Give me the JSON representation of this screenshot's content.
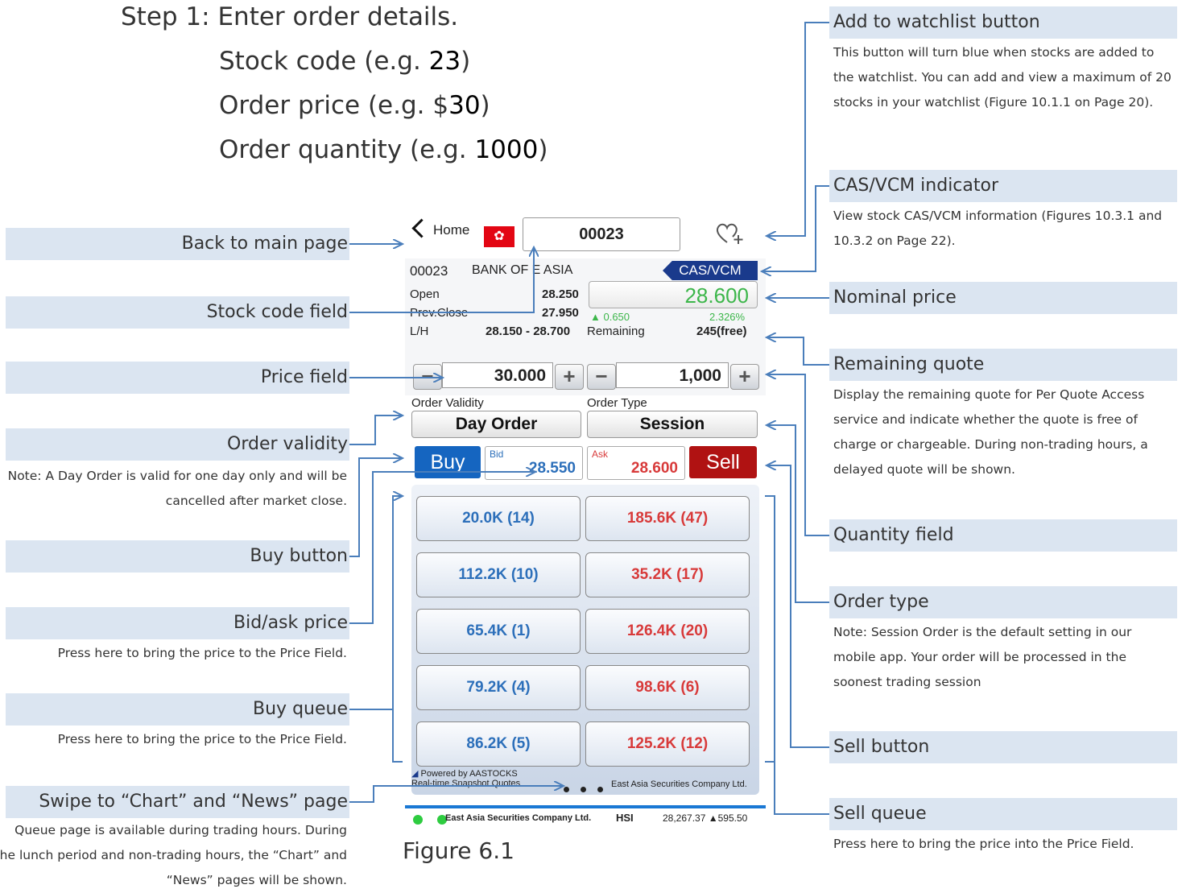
{
  "steps": {
    "title": "Step 1: Enter order details.",
    "stock_code": [
      "Stock code (e.g. ",
      "23",
      ")"
    ],
    "order_price": [
      "Order price (e.g. $",
      "30",
      ")"
    ],
    "order_qty": [
      "Order quantity (e.g. ",
      "1000",
      ")"
    ]
  },
  "left_callouts": [
    {
      "label": "Back to main page"
    },
    {
      "label": "Stock code field"
    },
    {
      "label": "Price field"
    },
    {
      "label": "Order validity",
      "note": "Note: A Day Order is valid for one day only and will be cancelled after market close."
    },
    {
      "label": "Buy button"
    },
    {
      "label": "Bid/ask price",
      "note": "Press here to bring the price to the Price Field."
    },
    {
      "label": "Buy queue",
      "note": "Press here to bring the price to the Price Field."
    },
    {
      "label": "Swipe to “Chart” and “News” page",
      "note": "Queue page is available during trading hours. During the lunch period and non-trading hours, the “Chart” and “News” pages will be shown."
    }
  ],
  "right_callouts": [
    {
      "label": "Add to watchlist button",
      "note": "This button will turn blue when stocks are added to the watchlist. You can add and view a maximum of 20 stocks in your watchlist (Figure 10.1.1 on Page 20)."
    },
    {
      "label": "CAS/VCM indicator",
      "note": "View stock CAS/VCM information (Figures 10.3.1 and 10.3.2 on Page 22)."
    },
    {
      "label": "Nominal price"
    },
    {
      "label": "Remaining quote",
      "note": "Display the remaining quote for Per Quote Access service and indicate whether the quote is free of charge or chargeable. During non-trading hours, a delayed quote will be shown."
    },
    {
      "label": "Quantity field"
    },
    {
      "label": "Order type",
      "note": "Note: Session Order is the default setting in our mobile app. Your order will be processed in the soonest trading session"
    },
    {
      "label": "Sell button"
    },
    {
      "label": "Sell queue",
      "note": "Press here to bring the price into the Price Field."
    }
  ],
  "figure_caption": "Figure 6.1",
  "app": {
    "back_label": "Home",
    "stock_code": "00023",
    "stock_name": "BANK OF E ASIA",
    "cas_vcm": "CAS/VCM",
    "open_label": "Open",
    "open_value": "28.250",
    "prev_close_label": "Prev.Close",
    "prev_close_value": "27.950",
    "lh_label": "L/H",
    "lh_value": "28.150 - 28.700",
    "nominal": "28.600",
    "change": "▲ 0.650",
    "change_pct": "2.326%",
    "remaining_label": "Remaining",
    "remaining_value": "245(free)",
    "price": "30.000",
    "quantity": "1,000",
    "order_validity_label": "Order Validity",
    "order_validity": "Day Order",
    "order_type_label": "Order Type",
    "order_type": "Session",
    "buy": "Buy",
    "sell": "Sell",
    "bid_label": "Bid",
    "bid_value": "28.550",
    "ask_label": "Ask",
    "ask_value": "28.600",
    "bid_queue": [
      "20.0K (14)",
      "112.2K (10)",
      "65.4K (1)",
      "79.2K (4)",
      "86.2K (5)"
    ],
    "ask_queue": [
      "185.6K (47)",
      "35.2K (17)",
      "126.4K (20)",
      "98.6K (6)",
      "125.2K (12)"
    ],
    "powered_by": "Powered by AASTOCKS",
    "snapshot": "Real-time Snapshot Quotes",
    "broker": "East Asia Securities Company Ltd.",
    "ticker_broker": "East Asia Securities Company Ltd.",
    "hsi_label": "HSI",
    "hsi_value": "28,267.37 ▲595.50",
    "colors": {
      "accent_blue": "#1565c0",
      "sell_red": "#b01212",
      "up_green": "#3cb64a",
      "callout_bar": "#dbe5f1"
    }
  }
}
